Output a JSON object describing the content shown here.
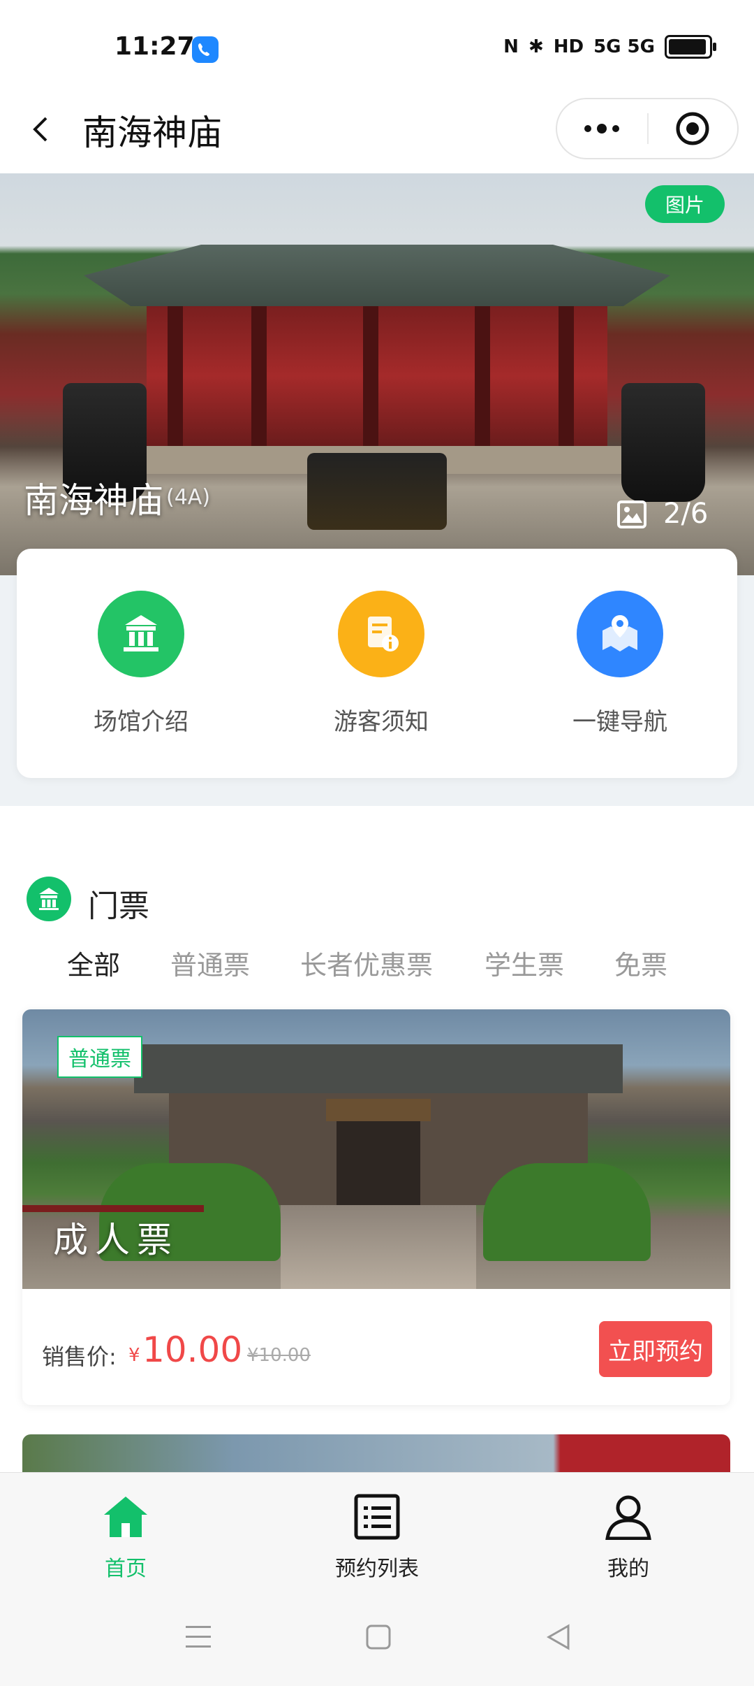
{
  "status_bar": {
    "time": "11:27",
    "right_text": "5G  5G"
  },
  "nav": {
    "title": "南海神庙"
  },
  "banner": {
    "tag": "图片",
    "name": "南海神庙",
    "level": "(4A)",
    "counter": "2/6"
  },
  "features": [
    {
      "label": "场馆介绍",
      "icon": "pavilion-icon",
      "color": "#23c466"
    },
    {
      "label": "游客须知",
      "icon": "notice-icon",
      "color": "#fbb117"
    },
    {
      "label": "一键导航",
      "icon": "map-pin-icon",
      "color": "#2f86ff"
    }
  ],
  "tickets": {
    "title": "门票",
    "tabs": [
      "全部",
      "普通票",
      "长者优惠票",
      "学生票",
      "免票"
    ],
    "active_tab": "全部",
    "cards": [
      {
        "tag": "普通票",
        "name": "成人票",
        "price_label": "销售价:",
        "currency": "¥",
        "price": "10.00",
        "original_price": "¥10.00",
        "button": "立即预约"
      }
    ]
  },
  "tabbar": {
    "items": [
      {
        "label": "首页",
        "icon": "home-icon",
        "active": true
      },
      {
        "label": "预约列表",
        "icon": "list-icon",
        "active": false
      },
      {
        "label": "我的",
        "icon": "user-icon",
        "active": false
      }
    ]
  },
  "colors": {
    "accent_green": "#13c06b",
    "price_red": "#f04848"
  }
}
